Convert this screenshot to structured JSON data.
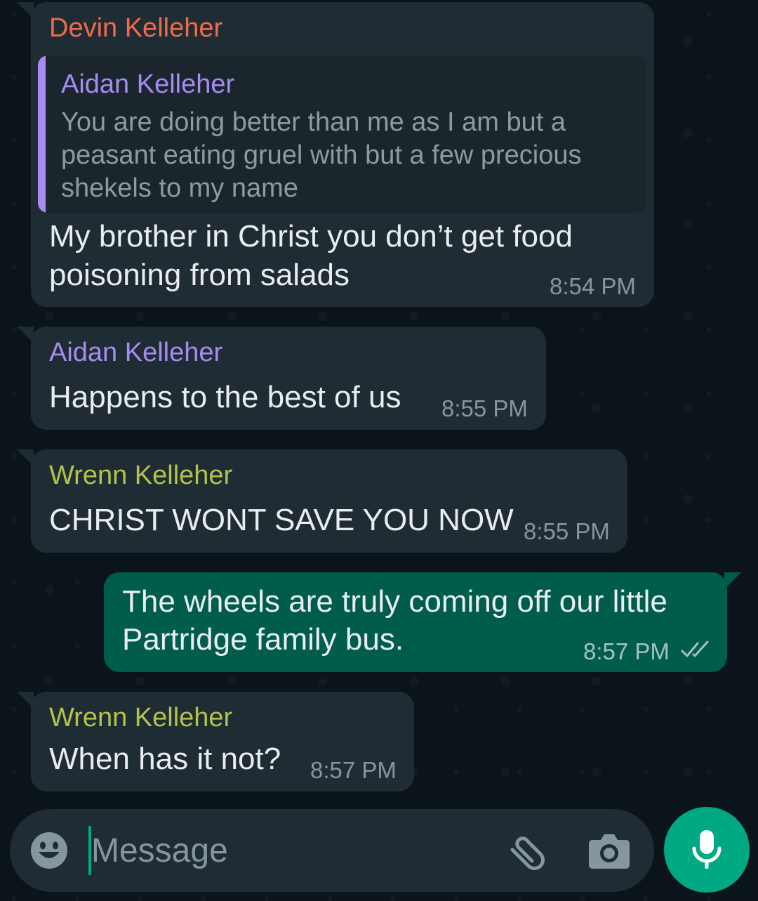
{
  "colors": {
    "devin": "#ef6b4a",
    "aidan": "#a68cf1",
    "wrenn": "#b2c34c",
    "accent": "#00a884"
  },
  "messages": [
    {
      "sender": "Devin Kelleher",
      "quote": {
        "sender": "Aidan Kelleher",
        "text": "You are doing better than me as I am but a peasant eating gruel with but a few precious shekels to my name"
      },
      "lines": [
        "My brother in Christ you don’t get food",
        "poisoning from salads"
      ],
      "time": "8:54 PM"
    },
    {
      "sender": "Aidan Kelleher",
      "lines": [
        "Happens to the best of us"
      ],
      "time": "8:55 PM"
    },
    {
      "sender": "Wrenn Kelleher",
      "lines": [
        "CHRIST WONT SAVE YOU NOW"
      ],
      "time": "8:55 PM"
    },
    {
      "sender": "",
      "lines": [
        "The wheels are truly coming off our little",
        "Partridge family bus."
      ],
      "time": "8:57 PM",
      "status_icon": "double-check-icon"
    },
    {
      "sender": "Wrenn Kelleher",
      "lines": [
        "When has it not?"
      ],
      "time": "8:57 PM"
    }
  ],
  "composer": {
    "placeholder": "Message",
    "emoji_icon": "emoji-icon",
    "attach_icon": "paperclip-icon",
    "camera_icon": "camera-icon",
    "mic_icon": "mic-icon"
  }
}
